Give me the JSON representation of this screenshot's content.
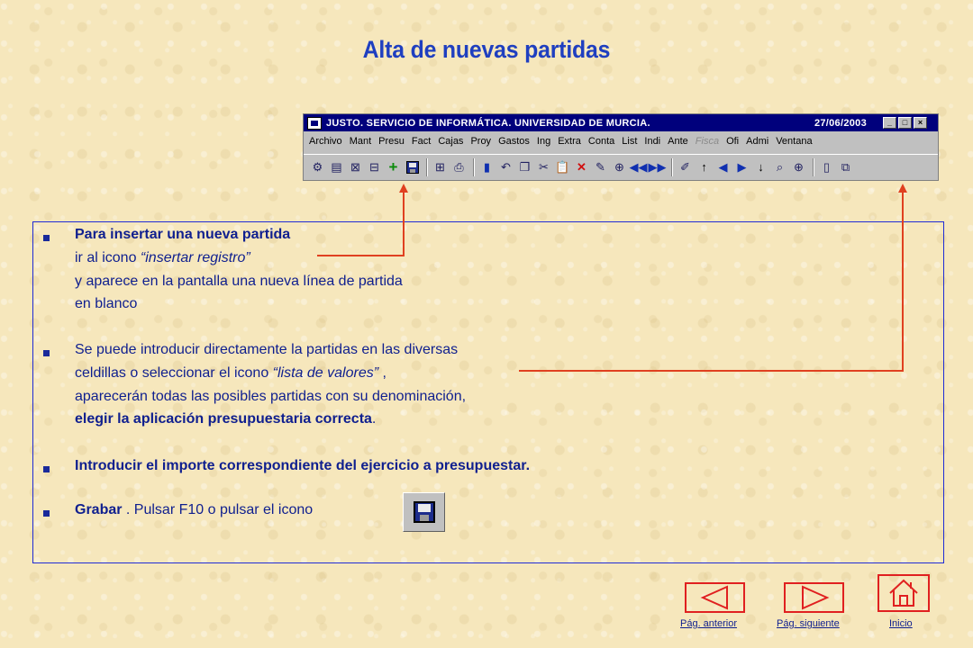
{
  "page": {
    "title": "Alta de nuevas partidas"
  },
  "window": {
    "title": "JUSTO. SERVICIO DE INFORMÁTICA. UNIVERSIDAD DE MURCIA.",
    "date": "27/06/2003",
    "controls": [
      "_",
      "□",
      "×"
    ],
    "menu": [
      {
        "label": "Archivo"
      },
      {
        "label": "Mant"
      },
      {
        "label": "Presu"
      },
      {
        "label": "Fact"
      },
      {
        "label": "Cajas"
      },
      {
        "label": "Proy"
      },
      {
        "label": "Gastos"
      },
      {
        "label": "Ing"
      },
      {
        "label": "Extra"
      },
      {
        "label": "Conta"
      },
      {
        "label": "List"
      },
      {
        "label": "Indi"
      },
      {
        "label": "Ante"
      },
      {
        "label": "Fisca",
        "disabled": true
      },
      {
        "label": "Ofi"
      },
      {
        "label": "Admi"
      },
      {
        "label": "Ventana"
      }
    ],
    "toolbar_icons": [
      "query-icon",
      "query-all-icon",
      "cancel-query-icon",
      "execute-query-icon",
      "insert-record-icon",
      "save-icon",
      "print-preview-icon",
      "print-icon",
      "exit-icon",
      "undo-icon",
      "copy-icon",
      "cut-icon",
      "paste-icon",
      "delete-record-icon",
      "edit-icon",
      "duplicate-icon",
      "first-record-icon",
      "last-record-icon",
      "list-of-values-icon",
      "up-arrow-icon",
      "prev-icon",
      "next-icon",
      "down-arrow-icon",
      "search-icon",
      "zoom-icon",
      "clipboard-icon",
      "window-icon"
    ]
  },
  "content": {
    "item1": {
      "line1": "Para insertar una nueva partida",
      "line2_pre": "ir al icono ",
      "line2_em": "“insertar registro”",
      "line3": "y aparece en la pantalla una nueva línea de partida",
      "line4": "en blanco"
    },
    "item2": {
      "line1": "Se puede introducir directamente la partidas en las diversas",
      "line2_pre": "celdillas o seleccionar el icono  ",
      "line2_em": "“lista de valores” ",
      "line2_post": ",",
      "line3": "aparecerán todas las posibles partidas con su denominación,",
      "line4_bold": "elegir la aplicación presupuestaria correcta",
      "line4_post": "."
    },
    "item3": {
      "line1": "Introducir el importe correspondiente del ejercicio a presupuestar."
    },
    "item4": {
      "bold": "Grabar",
      "rest": " . Pulsar F10 o pulsar el icono"
    }
  },
  "nav": {
    "prev_label": "Pág. anterior",
    "next_label": "Pág. siguiente",
    "home_label": "Inicio"
  },
  "colors": {
    "accent_text": "#1f3fc0",
    "body_text": "#0f1f8f",
    "arrow": "#e04020",
    "window_title_bg": "#00007c",
    "background": "#f6e7bc"
  }
}
